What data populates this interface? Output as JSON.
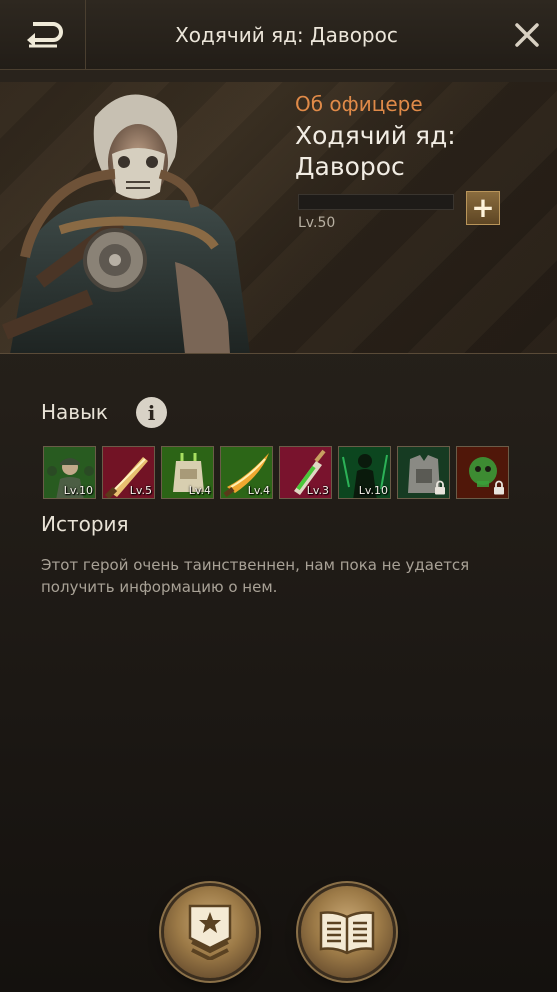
{
  "header": {
    "title": "Ходячий яд: Даворос"
  },
  "hero": {
    "section_label": "Об офицере",
    "name": "Ходячий яд: Даворос",
    "level": "Lv.50",
    "exp_fraction": 0.0,
    "plus_label": "+"
  },
  "skills": {
    "title": "Навык",
    "info_label": "i",
    "items": [
      {
        "icon": "soldier-squad-skill-icon",
        "level": "Lv.10",
        "locked": false
      },
      {
        "icon": "red-dagger-skill-icon",
        "level": "Lv.5",
        "locked": false
      },
      {
        "icon": "green-armor-skill-icon",
        "level": "Lv.4",
        "locked": false
      },
      {
        "icon": "flaming-blade-skill-icon",
        "level": "Lv.4",
        "locked": false
      },
      {
        "icon": "poison-syringe-skill-icon",
        "level": "Lv.3",
        "locked": false
      },
      {
        "icon": "shadow-figure-skill-icon",
        "level": "Lv.10",
        "locked": false
      },
      {
        "icon": "armor-vest-skill-icon",
        "level": "",
        "locked": true
      },
      {
        "icon": "toxic-skull-skill-icon",
        "level": "",
        "locked": true
      }
    ]
  },
  "history": {
    "title": "История",
    "text": "Этот герой очень таинственнен, нам пока не удается получить информацию о нем."
  },
  "bottom_nav": {
    "rank_icon": "military-rank-icon",
    "book_icon": "open-book-icon"
  },
  "colors": {
    "accent_orange": "#e08a48",
    "gold": "#b9955a",
    "background": "#241f19"
  }
}
